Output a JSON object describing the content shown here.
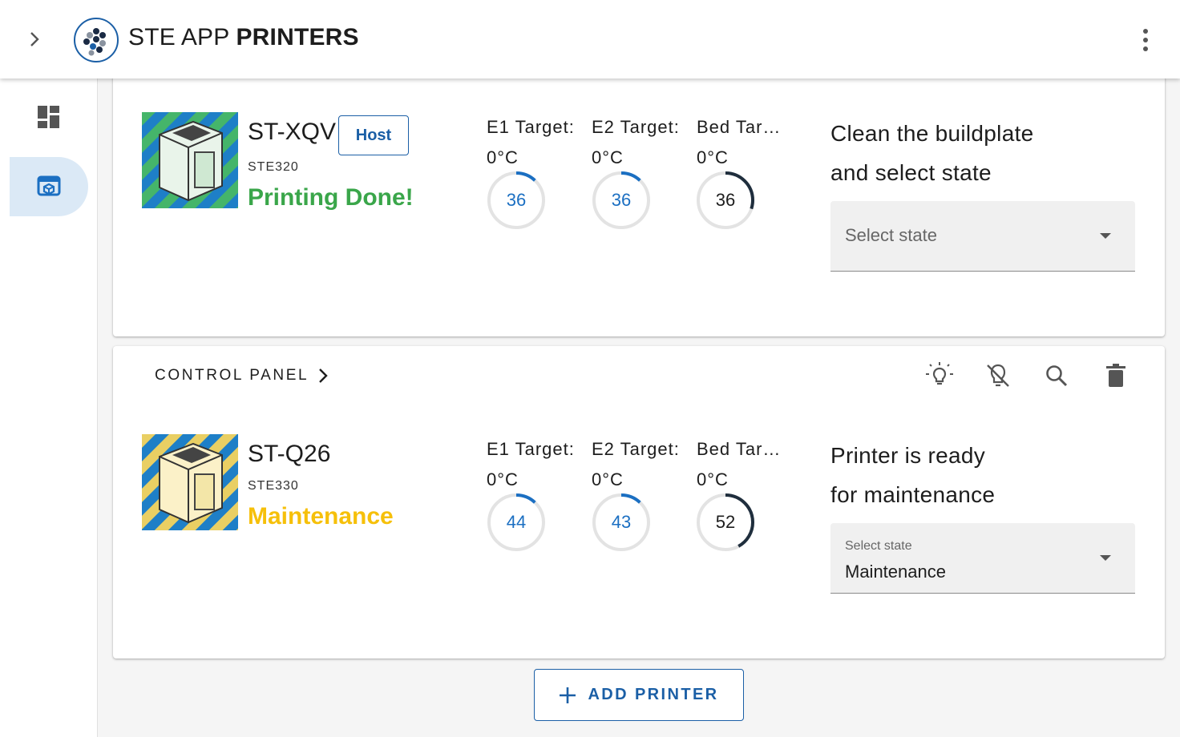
{
  "app": {
    "title_light": "STE APP",
    "title_bold": "PRINTERS"
  },
  "icons": {
    "expand": "chevron-right-icon",
    "menu": "more-vert-icon",
    "dashboard": "dashboard-icon",
    "printers": "printer-icon"
  },
  "colors": {
    "accent": "#1b5fa6",
    "done": "#3aa64a",
    "maintenance": "#f6c00a",
    "active_nav": "#dbe9f6"
  },
  "printers": [
    {
      "name": "ST-XQV",
      "badge": "Host",
      "model": "STE320",
      "status": "Printing Done!",
      "status_color": "#3aa64a",
      "thumb_stripe": "#45b56a",
      "temps": [
        {
          "label": "E1 Target:",
          "target": "0°C",
          "current": "36",
          "fraction": 0.12,
          "color": "#1b6fc2"
        },
        {
          "label": "E2 Target:",
          "target": "0°C",
          "current": "36",
          "fraction": 0.12,
          "color": "#1b6fc2"
        },
        {
          "label": "Bed Target:",
          "target": "0°C",
          "current": "36",
          "fraction": 0.3,
          "color": "#1f2e3d"
        }
      ],
      "message_line1": "Clean the buildplate",
      "message_line2": "and select state",
      "select": {
        "placeholder": "Select state",
        "value": ""
      }
    },
    {
      "name": "ST-Q26",
      "badge": "",
      "model": "STE330",
      "status": "Maintenance",
      "status_color": "#f6c00a",
      "thumb_stripe": "#e9cf63",
      "temps": [
        {
          "label": "E1 Target:",
          "target": "0°C",
          "current": "44",
          "fraction": 0.12,
          "color": "#1b6fc2"
        },
        {
          "label": "E2 Target:",
          "target": "0°C",
          "current": "43",
          "fraction": 0.12,
          "color": "#1b6fc2"
        },
        {
          "label": "Bed Target:",
          "target": "0°C",
          "current": "52",
          "fraction": 0.42,
          "color": "#1f2e3d"
        }
      ],
      "message_line1": "Printer is ready",
      "message_line2": "for maintenance",
      "select": {
        "label": "Select state",
        "value": "Maintenance"
      }
    }
  ],
  "control_panel": {
    "label": "CONTROL PANEL",
    "icons": [
      "lightbulb-icon",
      "lightbulb-off-icon",
      "search-icon",
      "delete-icon"
    ]
  },
  "add_printer": {
    "label": "ADD PRINTER",
    "icon": "plus-icon"
  }
}
